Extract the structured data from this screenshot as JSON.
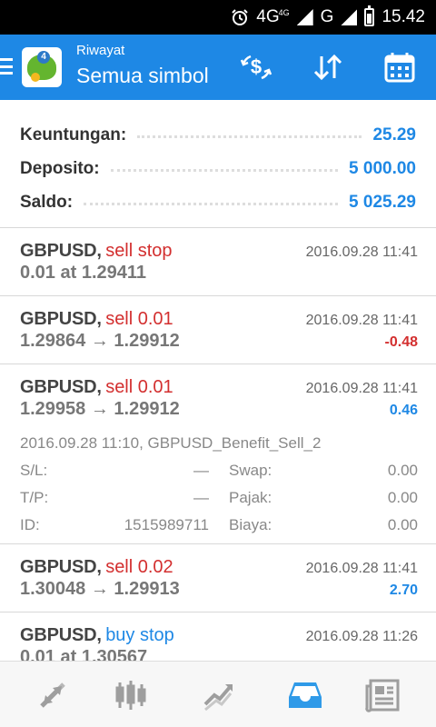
{
  "status_bar": {
    "network": "4G",
    "network_small": "4G",
    "network2": "G",
    "time": "15.42"
  },
  "header": {
    "subtitle": "Riwayat",
    "title": "Semua simbol",
    "icons": [
      "alarm-icon",
      "dollar-sync-icon",
      "sort-icon",
      "calendar-icon"
    ]
  },
  "summary": {
    "profit_label": "Keuntungan:",
    "profit_value": "25.29",
    "deposit_label": "Deposito:",
    "deposit_value": "5 000.00",
    "balance_label": "Saldo:",
    "balance_value": "5 025.29"
  },
  "orders": [
    {
      "symbol": "GBPUSD,",
      "side": "sell stop",
      "time": "2016.09.28 11:41",
      "price": "0.01 at 1.29411",
      "profit": ""
    },
    {
      "symbol": "GBPUSD,",
      "side": "sell 0.01",
      "time": "2016.09.28 11:41",
      "price": "1.29864 → 1.29912",
      "profit": "-0.48"
    },
    {
      "symbol": "GBPUSD,",
      "side": "sell 0.01",
      "time": "2016.09.28 11:41",
      "price": "1.29958 → 1.29912",
      "profit": "0.46",
      "details": {
        "open_info": "2016.09.28 11:10, GBPUSD_Benefit_Sell_2",
        "sl_label": "S/L:",
        "sl_value": "—",
        "swap_label": "Swap:",
        "swap_value": "0.00",
        "tp_label": "T/P:",
        "tp_value": "—",
        "tax_label": "Pajak:",
        "tax_value": "0.00",
        "id_label": "ID:",
        "id_value": "1515989711",
        "fee_label": "Biaya:",
        "fee_value": "0.00"
      }
    },
    {
      "symbol": "GBPUSD,",
      "side": "sell 0.02",
      "time": "2016.09.28 11:41",
      "price": "1.30048 → 1.29913",
      "profit": "2.70"
    },
    {
      "symbol": "GBPUSD,",
      "side": "buy stop",
      "time": "2016.09.28 11:26",
      "price": "0.01 at 1.30567",
      "profit": ""
    }
  ],
  "colors": {
    "accent": "#1e88e5",
    "sell": "#d32f2f",
    "buy": "#1e88e5",
    "loss": "#d32f2f",
    "gain": "#1e88e5"
  },
  "bottom_nav": {
    "items": [
      "quotes-icon",
      "chart-icon",
      "trade-icon",
      "history-icon",
      "news-icon"
    ],
    "active": "history-icon"
  }
}
